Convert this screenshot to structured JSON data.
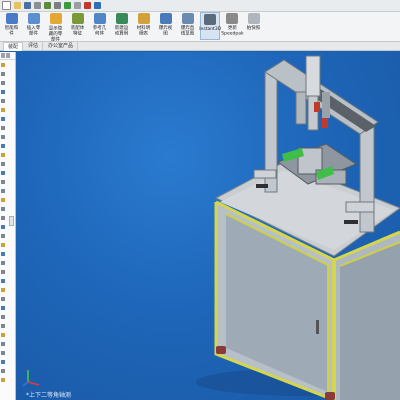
{
  "ribbon": {
    "buttons": [
      {
        "label": "智能和\n件",
        "icon": "smart-fastener-icon"
      },
      {
        "label": "插入零\n部件",
        "icon": "insert-component-icon"
      },
      {
        "label": "显示隐\n藏的零\n部件",
        "icon": "show-hidden-icon"
      },
      {
        "label": "装配体\n特征",
        "icon": "assembly-feature-icon"
      },
      {
        "label": "参考几\n何体",
        "icon": "reference-geometry-icon"
      },
      {
        "label": "新建运\n动算例",
        "icon": "new-motion-study-icon"
      },
      {
        "label": "材料明\n细表",
        "icon": "bill-of-materials-icon"
      },
      {
        "label": "爆炸视\n图",
        "icon": "exploded-view-icon"
      },
      {
        "label": "爆炸直\n线草图",
        "icon": "explode-line-sketch-icon"
      },
      {
        "label": "Instant3D",
        "icon": "instant3d-icon",
        "selected": true
      },
      {
        "label": "更新\nSpeedpak",
        "icon": "speedpak-icon"
      },
      {
        "label": "拍快照",
        "icon": "snapshot-icon"
      }
    ]
  },
  "tabs": [
    {
      "label": "装配",
      "active": true
    },
    {
      "label": "评估",
      "active": false
    },
    {
      "label": "办公室产品",
      "active": false
    }
  ],
  "viewport": {
    "triad_label": "*上下二等角轴测"
  },
  "colors": {
    "viewport_bg": "#1e66b9",
    "frame_yellow": "#d6d64a",
    "aluminum": "#c8ccd0",
    "accent_green": "#3fbf4a"
  }
}
